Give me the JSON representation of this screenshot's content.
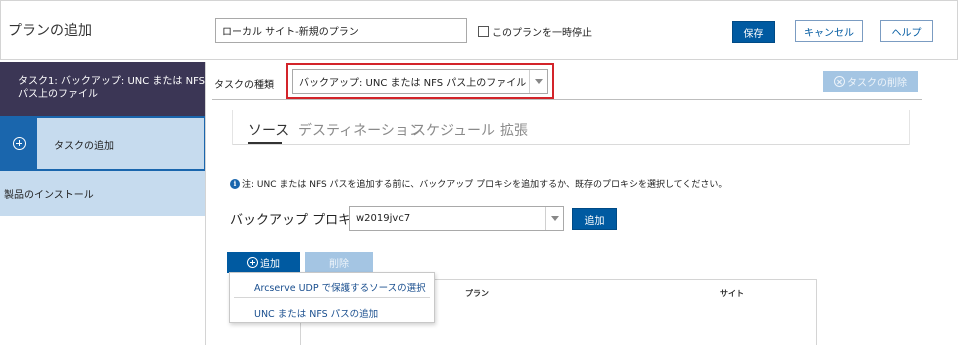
{
  "header": {
    "title": "プランの追加",
    "plan_name_value": "ローカル サイト-新規のプラン",
    "pause_label": "このプランを一時停止",
    "save_label": "保存",
    "cancel_label": "キャンセル",
    "help_label": "ヘルプ"
  },
  "sidebar": {
    "task_item": "タスク1: バックアップ: UNC または NFS パス上のファイル",
    "add_task_label": "タスクの追加",
    "install_label": "製品のインストール"
  },
  "task": {
    "type_label": "タスクの種類",
    "type_value": "バックアップ: UNC または NFS パス上のファイル",
    "delete_label": "タスクの削除"
  },
  "tabs": [
    {
      "label": "ソース",
      "active": true
    },
    {
      "label": "デスティネーション",
      "active": false
    },
    {
      "label": "スケジュール",
      "active": false
    },
    {
      "label": "拡張",
      "active": false
    }
  ],
  "source": {
    "note_text": "注: UNC または NFS パスを追加する前に、バックアップ プロキシを追加するか、既存のプロキシを選択してください。",
    "proxy_label": "バックアップ プロキシ",
    "proxy_value": "w2019jvc7",
    "proxy_add_label": "追加",
    "add_label": "追加",
    "remove_label": "削除",
    "table_headers": [
      "プラン",
      "サイト"
    ],
    "menu_items": [
      "Arcserve UDP で保護するソースの選択",
      "UNC または NFS パスの追加"
    ]
  },
  "colors": {
    "primary": "#005aa1",
    "sidebar_dark": "#3b3655",
    "sidebar_light": "#c6dbee",
    "highlight_border": "#d3242a",
    "disabled_button": "#a4c5e3"
  }
}
